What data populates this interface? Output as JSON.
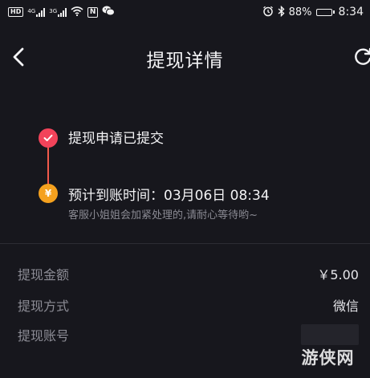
{
  "status_bar": {
    "hd_label": "HD",
    "network_1": "4G",
    "network_2": "3G",
    "icons": [
      "hd-icon",
      "signal-icon",
      "signal-icon",
      "wifi-icon",
      "nfc-icon",
      "wechat-icon",
      "alarm-icon",
      "bluetooth-icon",
      "battery-icon"
    ],
    "nfc_label": "N",
    "battery_percent": "88%",
    "battery_level": 0.88,
    "time": "8:34"
  },
  "nav": {
    "back_icon": "chevron-left-icon",
    "title": "提现详情",
    "refresh_icon": "refresh-icon"
  },
  "timeline": {
    "steps": [
      {
        "icon": "check-icon",
        "title": "提现申请已提交",
        "color": "#f2435a"
      },
      {
        "icon": "yen-icon",
        "icon_glyph": "¥",
        "title": "预计到账时间：03月06日 08:34",
        "note": "客服小姐姐会加紧处理的,请耐心等待哟~",
        "color": "#f5a11e"
      }
    ],
    "line_color": "#f25a4b"
  },
  "details": {
    "amount_label": "提现金额",
    "amount_value": "￥5.00",
    "method_label": "提现方式",
    "method_value": "微信",
    "account_label": "提现账号"
  },
  "watermark": {
    "text": "游侠网"
  },
  "colors": {
    "background": "#17171d",
    "accent_red": "#f2435a",
    "accent_orange": "#f5a11e"
  }
}
